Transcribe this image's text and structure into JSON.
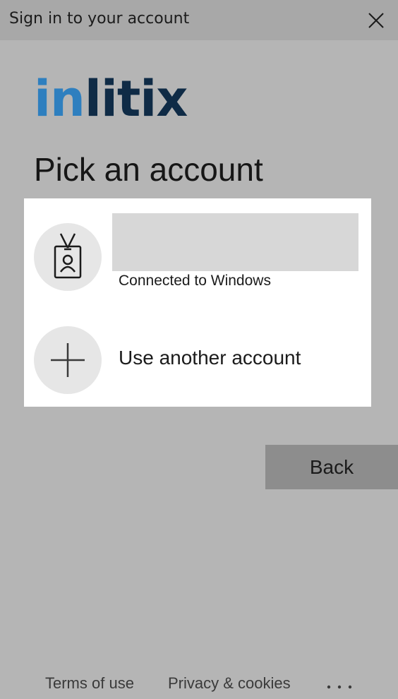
{
  "window": {
    "title": "Sign in to your account",
    "close_icon": "close-icon"
  },
  "logo": {
    "part1": "in",
    "part2": "litix",
    "colors": {
      "in": "#2e7fbf",
      "litix": "#0f2b46"
    }
  },
  "heading": "Pick an account",
  "accounts": [
    {
      "name": "",
      "subtitle": "Connected to Windows",
      "icon": "id-badge-icon"
    }
  ],
  "use_another": {
    "label": "Use another account",
    "icon": "plus-icon"
  },
  "back_button": "Back",
  "footer": {
    "terms": "Terms of use",
    "privacy": "Privacy & cookies",
    "more_icon": "ellipsis-icon"
  },
  "colors": {
    "background": "#b5b5b5",
    "titlebar": "#a8a8a8",
    "panel": "#ffffff",
    "back_button": "#8d8d8d"
  }
}
